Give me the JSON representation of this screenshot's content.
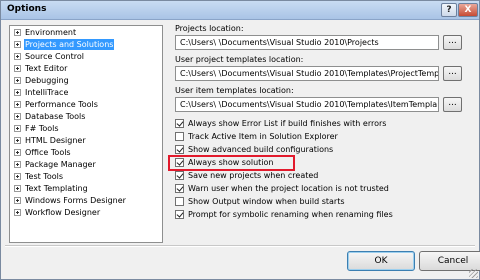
{
  "window": {
    "title": "Options",
    "help_label": "?",
    "close_label": "X"
  },
  "tree": {
    "items": [
      {
        "label": "Environment",
        "selected": false
      },
      {
        "label": "Projects and Solutions",
        "selected": true
      },
      {
        "label": "Source Control",
        "selected": false
      },
      {
        "label": "Text Editor",
        "selected": false
      },
      {
        "label": "Debugging",
        "selected": false
      },
      {
        "label": "IntelliTrace",
        "selected": false
      },
      {
        "label": "Performance Tools",
        "selected": false
      },
      {
        "label": "Database Tools",
        "selected": false
      },
      {
        "label": "F# Tools",
        "selected": false
      },
      {
        "label": "HTML Designer",
        "selected": false
      },
      {
        "label": "Office Tools",
        "selected": false
      },
      {
        "label": "Package Manager",
        "selected": false
      },
      {
        "label": "Test Tools",
        "selected": false
      },
      {
        "label": "Text Templating",
        "selected": false
      },
      {
        "label": "Windows Forms Designer",
        "selected": false
      },
      {
        "label": "Workflow Designer",
        "selected": false
      }
    ]
  },
  "settings": {
    "projects_location": {
      "label": "Projects location:",
      "value": "C:\\Users\\        \\Documents\\Visual Studio 2010\\Projects"
    },
    "user_project_templates": {
      "label": "User project templates location:",
      "value": "C:\\Users\\        \\Documents\\Visual Studio 2010\\Templates\\ProjectTemp"
    },
    "user_item_templates": {
      "label": "User item templates location:",
      "value": "C:\\Users\\        \\Documents\\Visual Studio 2010\\Templates\\ItemTempla"
    },
    "browse_label": "...",
    "checkboxes": [
      {
        "label": "Always show Error List if build finishes with errors",
        "checked": true
      },
      {
        "label": "Track Active Item in Solution Explorer",
        "checked": false
      },
      {
        "label": "Show advanced build configurations",
        "checked": true
      },
      {
        "label": "Always show solution",
        "checked": true
      },
      {
        "label": "Save new projects when created",
        "checked": true
      },
      {
        "label": "Warn user when the project location is not trusted",
        "checked": true
      },
      {
        "label": "Show Output window when build starts",
        "checked": false
      },
      {
        "label": "Prompt for symbolic renaming when renaming files",
        "checked": true
      }
    ]
  },
  "buttons": {
    "ok": "OK",
    "cancel": "Cancel"
  },
  "colors": {
    "selection": "#3399ff",
    "highlight": "#e21a2c"
  }
}
